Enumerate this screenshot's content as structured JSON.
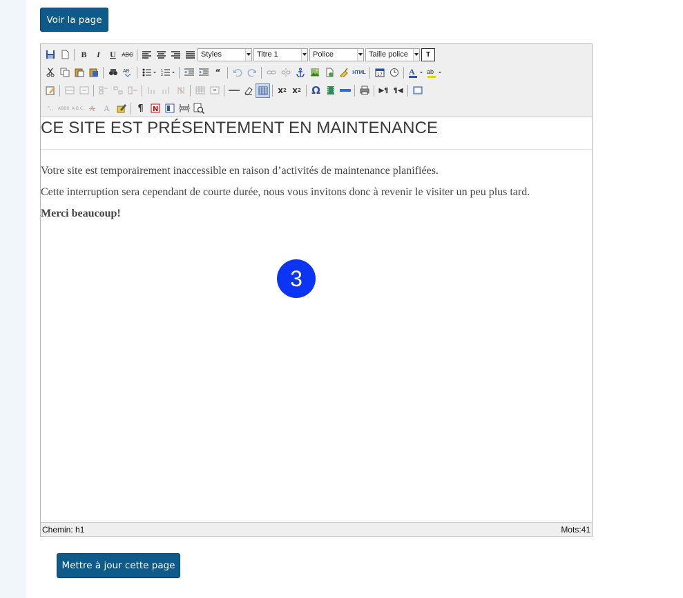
{
  "top_button": "Voir la page",
  "bottom_button": "Mettre à jour cette page",
  "toolbar": {
    "styles_select": "Styles",
    "format_select": "Titre 1",
    "font_select": "Police",
    "size_select": "Taille police",
    "text_box_label": "T"
  },
  "content": {
    "heading": "CE SITE EST PRÉSENTEMENT EN MAINTENANCE",
    "paragraph1": "Votre site est temporairement inaccessible en raison d’activités de maintenance planifiées.",
    "paragraph2": "Cette interruption sera cependant de courte durée, nous vous invitons donc à revenir le visiter un peu plus tard.",
    "paragraph3": "Merci beaucoup!"
  },
  "marker": {
    "number": "3",
    "color": "#0c34f5"
  },
  "statusbar": {
    "path": "Chemin: h1",
    "word_count": "Mots:41"
  },
  "colors": {
    "button": "#0e5a8a",
    "sidebar": "#f1f6fb",
    "toolbar": "#efefef"
  }
}
